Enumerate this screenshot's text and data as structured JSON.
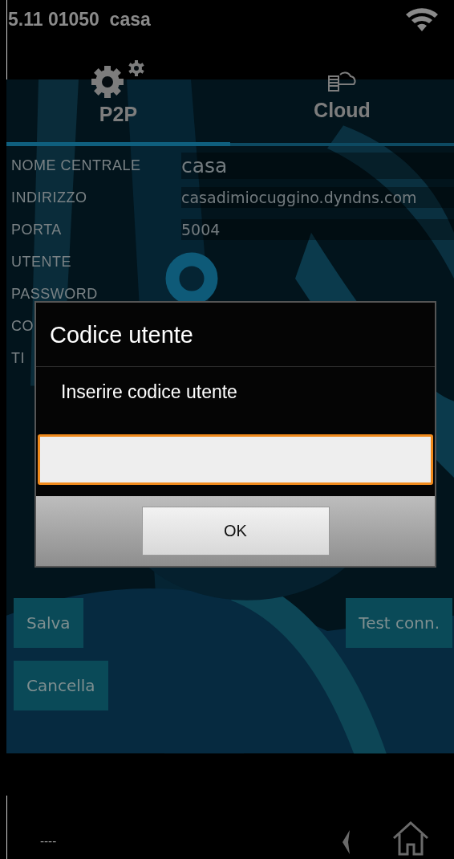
{
  "status_bar": {
    "text": "5.11 01050  casa"
  },
  "tabs": [
    {
      "label": "P2P",
      "selected": true,
      "kind": "gears"
    },
    {
      "label": "Cloud",
      "selected": false,
      "kind": "cloud"
    }
  ],
  "form": {
    "fields": [
      {
        "label": "NOME CENTRALE",
        "value": "casa"
      },
      {
        "label": "INDIRIZZO",
        "value": "casadimiocuggino.dyndns.com"
      },
      {
        "label": "PORTA",
        "value": "5004"
      },
      {
        "label": "UTENTE"
      },
      {
        "label": "PASSWORD"
      },
      {
        "label": "CO"
      },
      {
        "label": "TI"
      }
    ]
  },
  "loading": true,
  "dialog": {
    "title": "Codice utente",
    "message": "Inserire codice utente",
    "input": {
      "focused": true
    },
    "button": "OK"
  },
  "buttons": [
    {
      "label": "Salva"
    },
    {
      "label": "Test conn."
    },
    {
      "label": "Cancella"
    }
  ],
  "footer": {
    "text": "----"
  }
}
